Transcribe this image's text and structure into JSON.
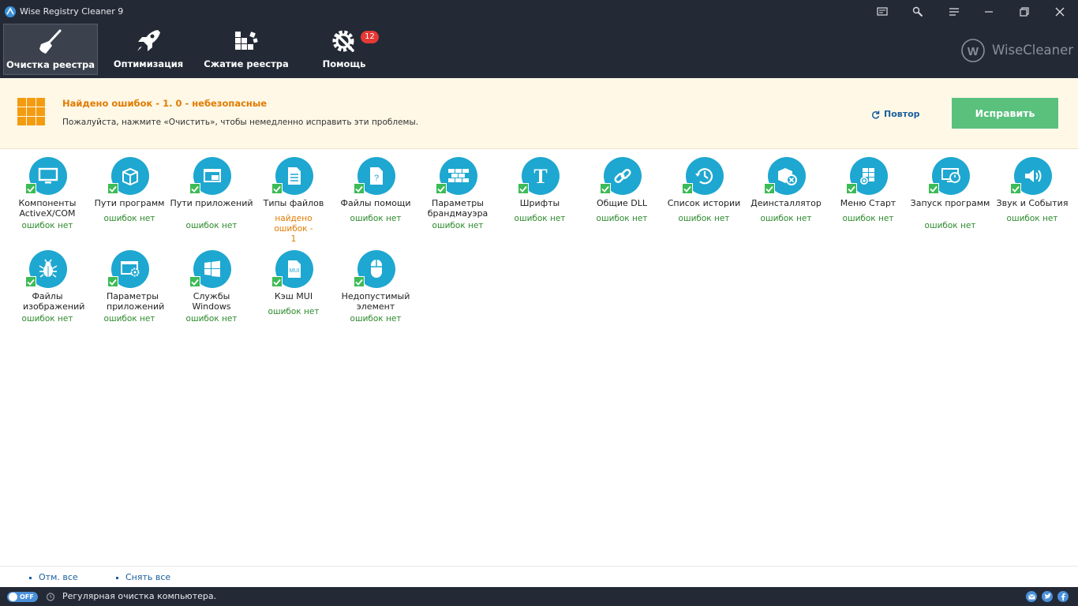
{
  "window": {
    "title": "Wise Registry Cleaner 9"
  },
  "nav": {
    "items": [
      {
        "label": "Очистка реестра",
        "icon": "broom-icon",
        "active": true
      },
      {
        "label": "Оптимизация",
        "icon": "rocket-icon",
        "active": false
      },
      {
        "label": "Сжатие реестра",
        "icon": "compress-blocks-icon",
        "active": false
      },
      {
        "label": "Помощь",
        "icon": "gear-wrench-icon",
        "active": false
      }
    ],
    "help_badge": "12"
  },
  "brand": {
    "letter": "W",
    "name": "WiseCleaner"
  },
  "status": {
    "title": "Найдено ошибок - 1. 0 - небезопасные",
    "description": "Пожалуйста, нажмите «Очистить», чтобы немедленно исправить эти проблемы.",
    "retry_label": "Повтор",
    "fix_label": "Исправить"
  },
  "categories": [
    {
      "name": "Компоненты ActiveX/COM",
      "status": "ошибок нет",
      "icon": "monitor-icon",
      "checked": true
    },
    {
      "name": "Пути программ",
      "status": "ошибок нет",
      "icon": "package-icon",
      "checked": true
    },
    {
      "name": "Пути приложений",
      "status": "ошибок нет",
      "icon": "windows-stack-icon",
      "checked": true
    },
    {
      "name": "Типы файлов",
      "status": "найдено ошибок - 1",
      "icon": "document-icon",
      "checked": true
    },
    {
      "name": "Файлы помощи",
      "status": "ошибок нет",
      "icon": "help-file-icon",
      "checked": true
    },
    {
      "name": "Параметры брандмауэра",
      "status": "ошибок нет",
      "icon": "firewall-icon",
      "checked": true
    },
    {
      "name": "Шрифты",
      "status": "ошибок нет",
      "icon": "font-icon",
      "checked": true
    },
    {
      "name": "Общие DLL",
      "status": "ошибок нет",
      "icon": "link-icon",
      "checked": true
    },
    {
      "name": "Список истории",
      "status": "ошибок нет",
      "icon": "history-icon",
      "checked": true
    },
    {
      "name": "Деинсталлятор",
      "status": "ошибок нет",
      "icon": "uninstall-icon",
      "checked": true
    },
    {
      "name": "Меню Старт",
      "status": "ошибок нет",
      "icon": "start-menu-icon",
      "checked": true
    },
    {
      "name": "Запуск программ",
      "status": "ошибок нет",
      "icon": "startup-icon",
      "checked": true
    },
    {
      "name": "Звук и События",
      "status": "ошибок нет",
      "icon": "speaker-icon",
      "checked": true
    },
    {
      "name": "Файлы изображений",
      "status": "ошибок нет",
      "icon": "bug-icon",
      "checked": true
    },
    {
      "name": "Параметры приложений",
      "status": "ошибок нет",
      "icon": "app-settings-icon",
      "checked": true
    },
    {
      "name": "Службы Windows",
      "status": "ошибок нет",
      "icon": "windows-logo-icon",
      "checked": true
    },
    {
      "name": "Кэш MUI",
      "status": "ошибок нет",
      "icon": "mui-file-icon",
      "mui_text": "MUI",
      "checked": true
    },
    {
      "name": "Недопустимый элемент",
      "status": "ошибок нет",
      "icon": "mouse-icon",
      "checked": true
    }
  ],
  "footer": {
    "select_all": "Отм. все",
    "deselect_all": "Снять все",
    "toggle_label": "OFF",
    "auto_clean_label": "Регулярная очистка компьютера."
  },
  "colors": {
    "header_bg": "#232a36",
    "accent_blue": "#1ea7d0",
    "fix_green": "#5ac17d",
    "warning_orange": "#e07b00",
    "ok_green": "#2c8a2c"
  }
}
